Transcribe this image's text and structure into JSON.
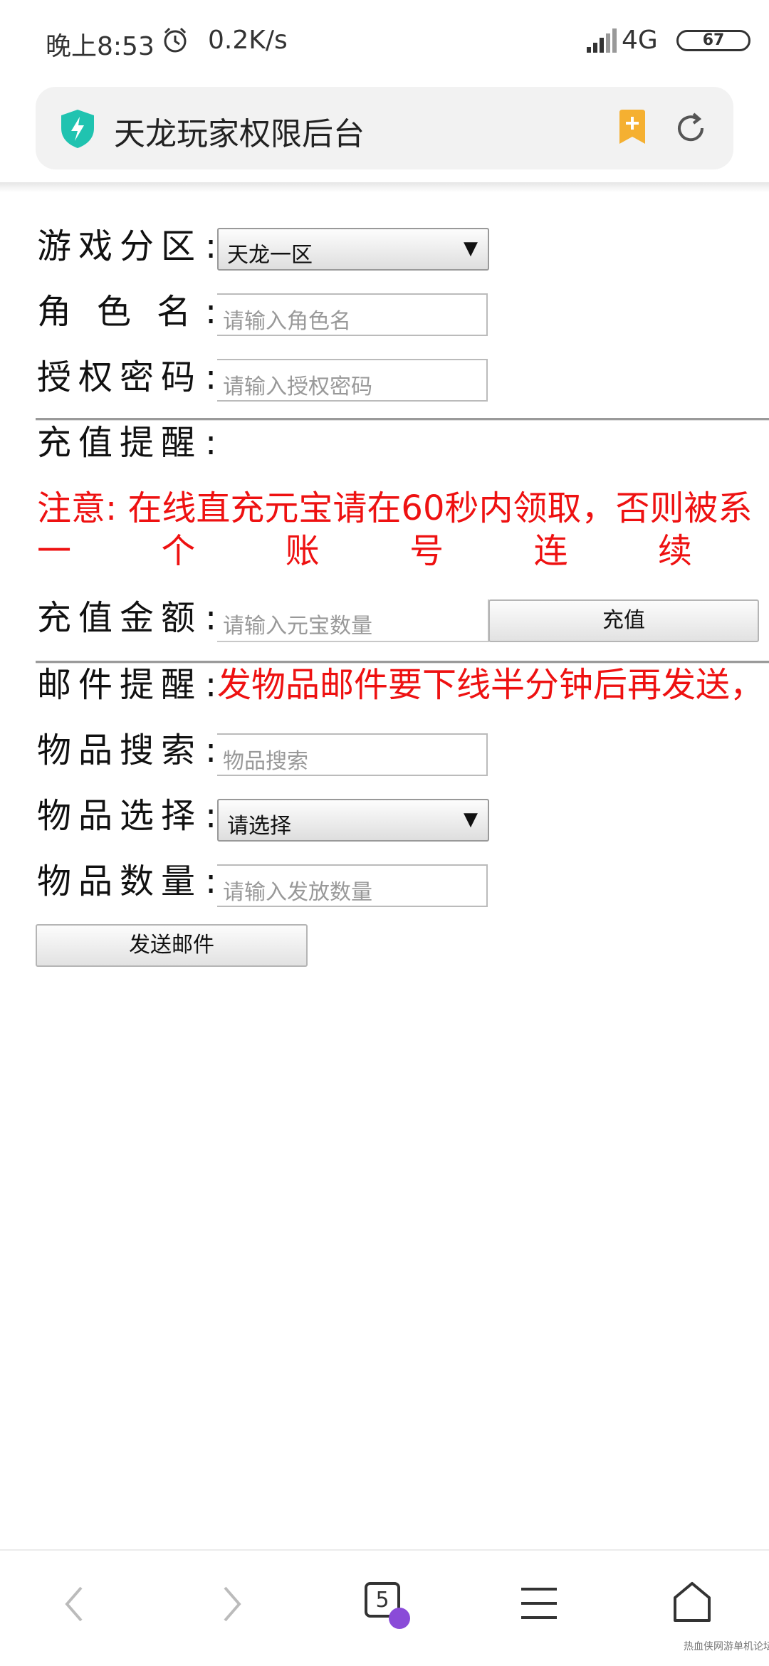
{
  "status_bar": {
    "time": "晚上8:53",
    "speed": "0.2K/s",
    "network": "4G",
    "battery": "67",
    "alarm_icon": "alarm-clock-icon",
    "signal_icon": "cell-signal-icon"
  },
  "address_bar": {
    "title": "天龙玩家权限后台",
    "shield_icon": "security-shield-icon",
    "bookmark_icon": "bookmark-add-icon",
    "refresh_icon": "refresh-icon",
    "accent_color": "#20c3b0"
  },
  "form": {
    "zone": {
      "label": "游戏分区",
      "colon": ":",
      "selected": "天龙一区"
    },
    "role": {
      "label": "角色名",
      "colon": ":",
      "placeholder": "请输入角色名"
    },
    "auth": {
      "label": "授权密码",
      "colon": ":",
      "placeholder": "请输入授权密码"
    },
    "recharge_notice": {
      "label": "充值提醒",
      "colon": ":"
    },
    "warning": {
      "line1": "注意: 在线直充元宝请在60秒内领取，否则被系",
      "line2_chars": [
        "一",
        "个",
        "账",
        "号",
        "连",
        "续"
      ]
    },
    "recharge": {
      "label": "充值金额",
      "colon": ":",
      "placeholder": "请输入元宝数量",
      "button": "充值"
    },
    "mail_notice": {
      "label": "邮件提醒",
      "colon": ":",
      "text": "发物品邮件要下线半分钟后再发送，"
    },
    "item_search": {
      "label": "物品搜索",
      "colon": ":",
      "placeholder": "物品搜索"
    },
    "item_select": {
      "label": "物品选择",
      "colon": ":",
      "selected": "请选择"
    },
    "item_count": {
      "label": "物品数量",
      "colon": ":",
      "placeholder": "请输入发放数量"
    },
    "send_button": "发送邮件"
  },
  "bottom_nav": {
    "back_icon": "chevron-left-icon",
    "forward_icon": "chevron-right-icon",
    "tabs_count": "5",
    "menu_icon": "hamburger-menu-icon",
    "home_icon": "home-icon",
    "incognito_color": "#8a4bd8"
  },
  "watermark": "热血侠网游单机论坛"
}
